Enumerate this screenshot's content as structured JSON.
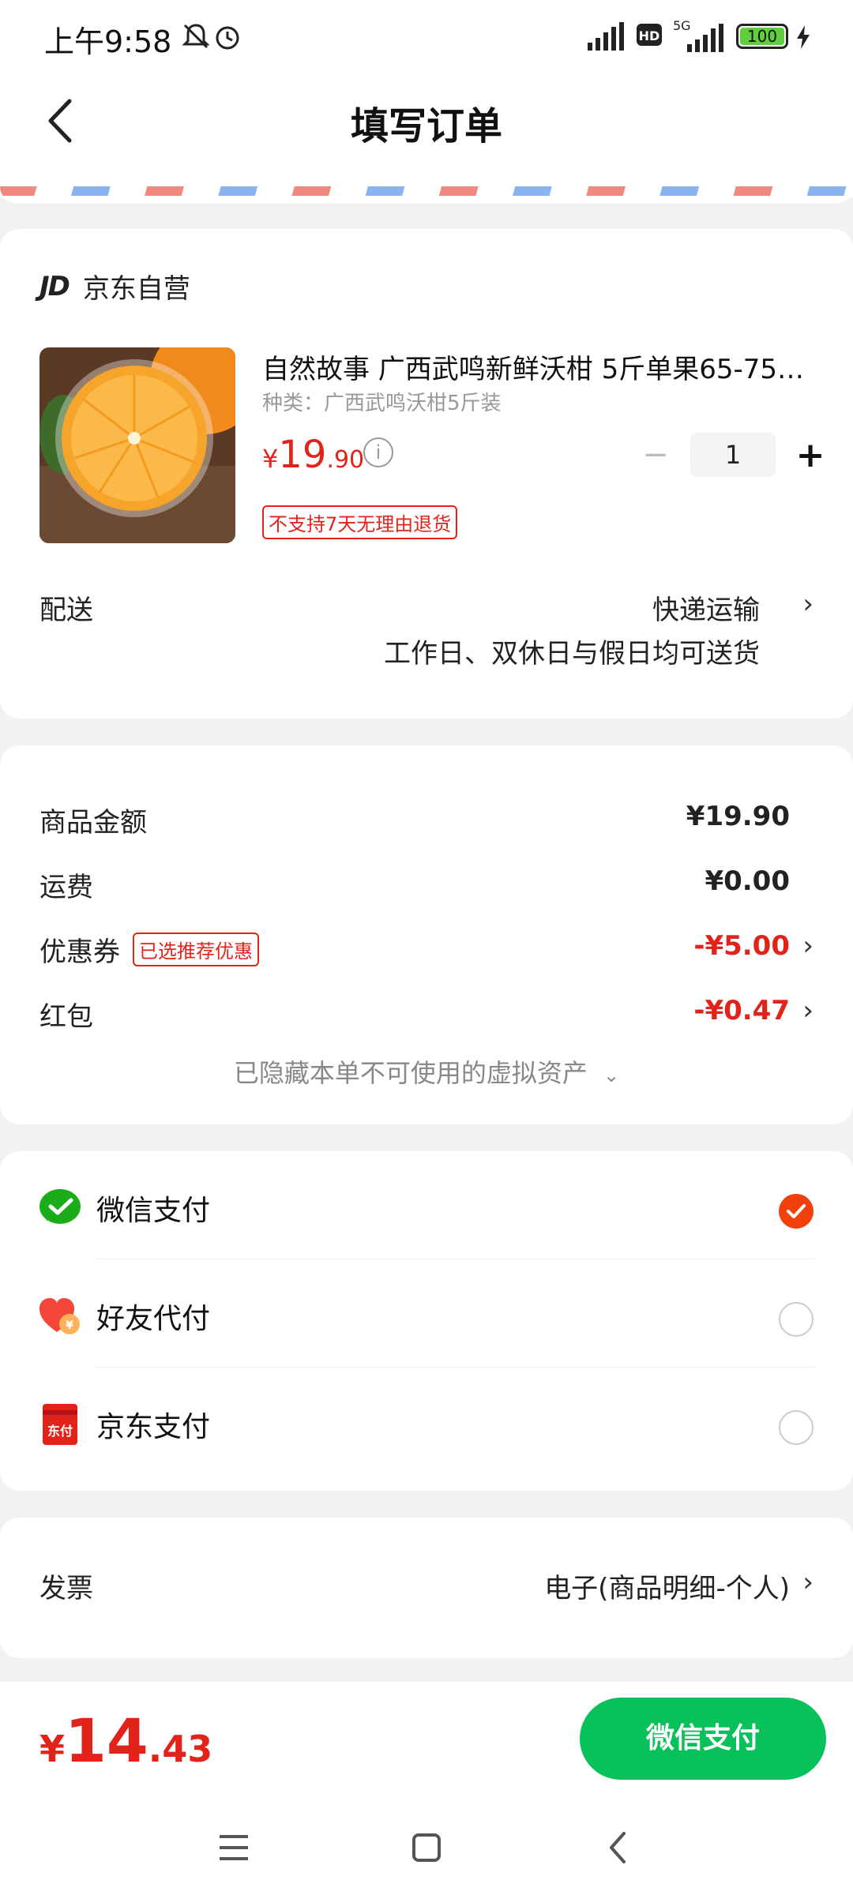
{
  "status_bar": {
    "time": "上午9:58",
    "battery": "100"
  },
  "header": {
    "title": "填写订单"
  },
  "shop": {
    "logo": "JD",
    "name": "京东自营"
  },
  "product": {
    "title": "自然故事 广西武鸣新鲜沃柑 5斤单果65-75mm",
    "spec": "种类：广西武鸣沃柑5斤装",
    "price_symbol": "¥",
    "price_int": "19",
    "price_dec": ".90",
    "quantity": "1",
    "return_tag": "不支持7天无理由退货"
  },
  "delivery": {
    "label": "配送",
    "method": "快递运输",
    "desc": "工作日、双休日与假日均可送货"
  },
  "price_detail": {
    "goods_label": "商品金额",
    "goods_value": "¥19.90",
    "shipping_label": "运费",
    "shipping_value": "¥0.00",
    "coupon_label": "优惠券",
    "coupon_badge": "已选推荐优惠",
    "coupon_value": "-¥5.00",
    "redpacket_label": "红包",
    "redpacket_value": "-¥0.47",
    "hidden_note": "已隐藏本单不可使用的虚拟资产"
  },
  "payment": {
    "options": [
      {
        "label": "微信支付",
        "icon": "wechat-pay-icon",
        "selected": true
      },
      {
        "label": "好友代付",
        "icon": "friend-pay-icon",
        "selected": false
      },
      {
        "label": "京东支付",
        "icon": "jd-pay-icon",
        "selected": false
      }
    ],
    "jd_pay_icon_text": "东付"
  },
  "invoice": {
    "label": "发票",
    "value": "电子(商品明细-个人)"
  },
  "footer": {
    "total_symbol": "¥",
    "total_int": "14",
    "total_dec": ".43",
    "pay_button": "微信支付"
  },
  "colors": {
    "accent": "#e2231a",
    "wechat_green": "#09c15a",
    "radio_selected": "#f2400d"
  }
}
